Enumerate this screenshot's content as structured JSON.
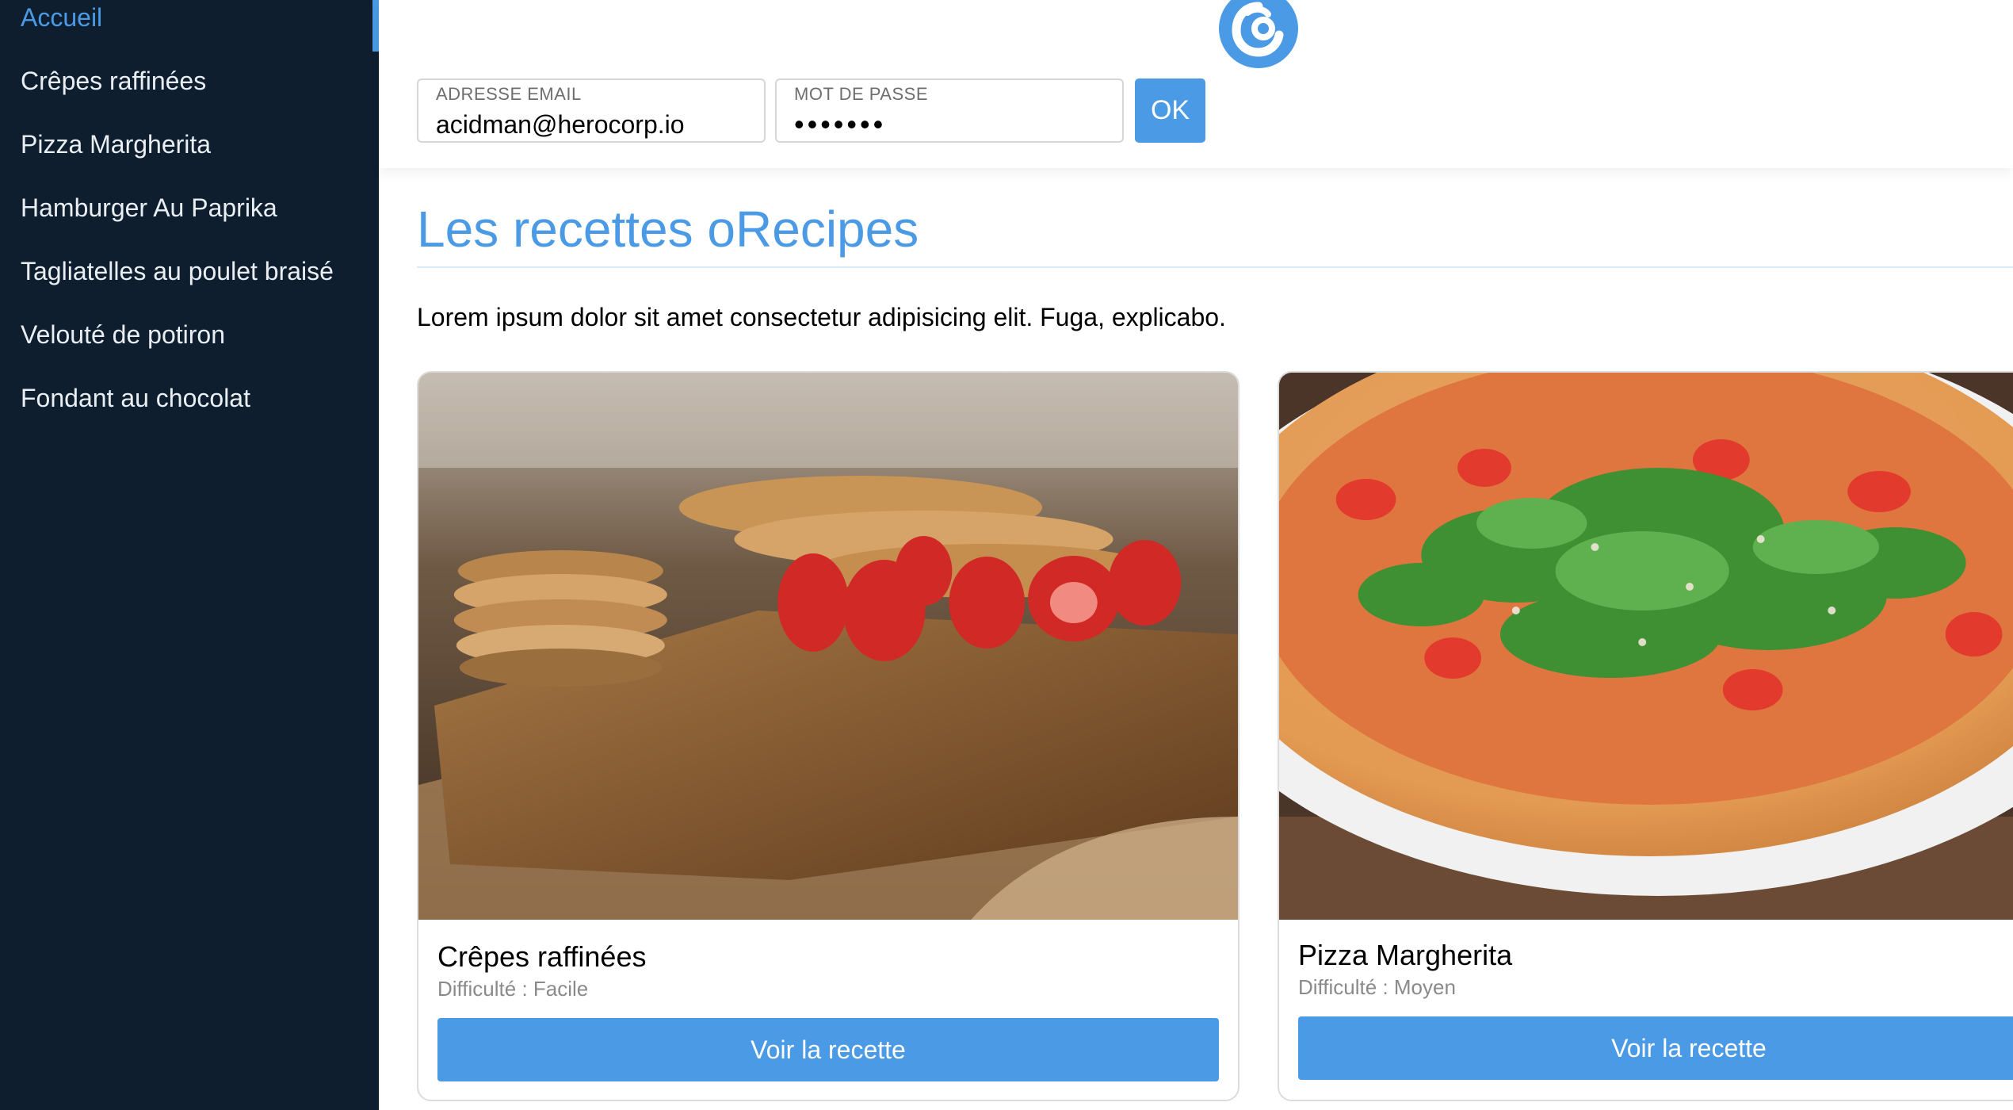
{
  "sidebar": {
    "items": [
      {
        "label": "Accueil",
        "active": true
      },
      {
        "label": "Crêpes raffinées"
      },
      {
        "label": "Pizza Margherita"
      },
      {
        "label": "Hamburger Au Paprika"
      },
      {
        "label": "Tagliatelles au poulet braisé"
      },
      {
        "label": "Velouté de potiron"
      },
      {
        "label": "Fondant au chocolat"
      }
    ]
  },
  "header": {
    "logo_icon": "orecipes-logo-icon",
    "email": {
      "label": "ADRESSE EMAIL",
      "value": "acidman@herocorp.io"
    },
    "password": {
      "label": "MOT DE PASSE",
      "value": "•••••••"
    },
    "ok_label": "OK"
  },
  "main": {
    "title": "Les recettes oRecipes",
    "intro": "Lorem ipsum dolor sit amet consectetur adipisicing elit. Fuga, explicabo.",
    "cards": [
      {
        "title": "Crêpes raffinées",
        "difficulty": "Difficulté : Facile",
        "button": "Voir la recette"
      },
      {
        "title": "Pizza Margherita",
        "difficulty": "Difficulté : Moyen",
        "button": "Voir la recette"
      }
    ]
  },
  "colors": {
    "accent": "#4a9ae5",
    "sidebar_bg": "#0e1e2f",
    "sidebar_text": "#e9eef3",
    "muted_text": "#8a8a8a"
  }
}
